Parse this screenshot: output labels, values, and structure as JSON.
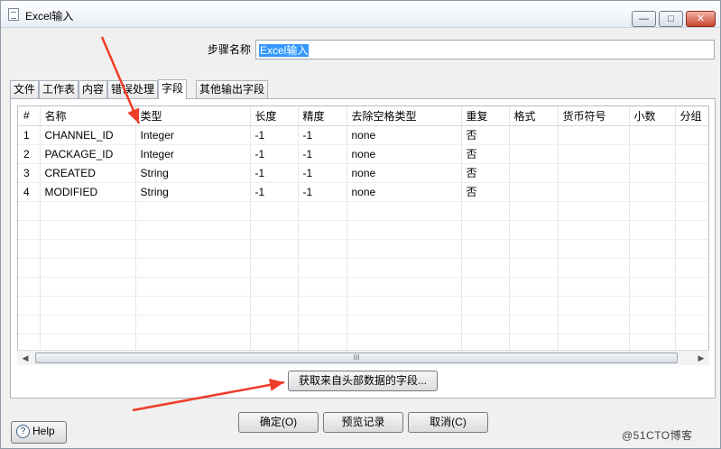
{
  "window": {
    "title": "Excel输入",
    "controls": {
      "minimize": "—",
      "maximize": "□",
      "close": "✕"
    }
  },
  "step_name": {
    "label": "步骤名称",
    "value": "Excel输入"
  },
  "tabs": [
    "文件",
    "工作表",
    "内容",
    "错误处理",
    "字段",
    "其他输出字段"
  ],
  "active_tab": "字段",
  "fields_table": {
    "columns": [
      "#",
      "名称",
      "类型",
      "长度",
      "精度",
      "去除空格类型",
      "重复",
      "格式",
      "货币符号",
      "小数",
      "分组"
    ],
    "rows": [
      [
        "1",
        "CHANNEL_ID",
        "Integer",
        "-1",
        "-1",
        "none",
        "否",
        "",
        "",
        "",
        ""
      ],
      [
        "2",
        "PACKAGE_ID",
        "Integer",
        "-1",
        "-1",
        "none",
        "否",
        "",
        "",
        "",
        ""
      ],
      [
        "3",
        "CREATED",
        "String",
        "-1",
        "-1",
        "none",
        "否",
        "",
        "",
        "",
        ""
      ],
      [
        "4",
        "MODIFIED",
        "String",
        "-1",
        "-1",
        "none",
        "否",
        "",
        "",
        "",
        ""
      ]
    ],
    "scroll_thumb_label": "III"
  },
  "buttons": {
    "get_fields": "获取来自头部数据的字段...",
    "ok": "确定(O)",
    "preview": "预览记录",
    "cancel": "取消(C)",
    "help": "Help"
  },
  "watermark": "@51CTO博客",
  "colors": {
    "annotation_arrow": "#f03c28",
    "selection": "#3399ff"
  }
}
